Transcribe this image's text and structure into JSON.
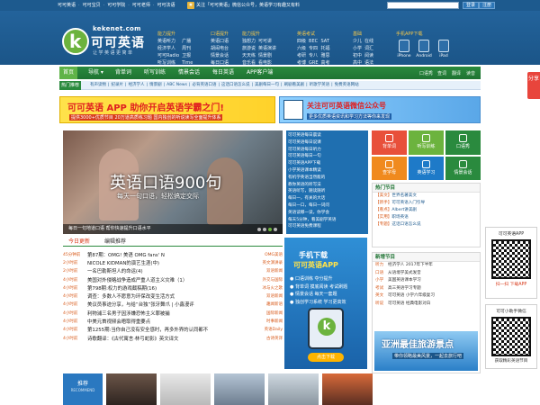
{
  "topbar": {
    "links": [
      "可可英语",
      "可可宝贝",
      "可可学院",
      "可可老师",
      "可可法语"
    ],
    "promo": "关注「可可英语」微信公众号，英语学习有趣又有料",
    "login": "登录",
    "register": "注册"
  },
  "logo": {
    "url": "kekenet.com",
    "name": "可可英语",
    "slogan": "让学英语更简单"
  },
  "nav_groups": [
    {
      "title": "能力提升",
      "items": [
        "英语听力",
        "经济学人",
        "可可Radio",
        "听写训练",
        "广播",
        "周刊",
        "卫报",
        "Time"
      ]
    },
    {
      "title": "口语提升",
      "items": [
        "英语口语",
        "胡闹电台",
        "情景会话",
        "每日口语"
      ]
    },
    {
      "title": "能力提升",
      "items": [
        "独想力",
        "旅游说",
        "天天练",
        "音乐看",
        "可可讲",
        "英语演讲",
        "情景剧",
        "看电影"
      ]
    },
    {
      "title": "英语考试",
      "items": [
        "四级",
        "六级",
        "考研",
        "考博",
        "BEC",
        "专四",
        "专八",
        "GRE",
        "SAT",
        "托福",
        "雅思",
        "高考"
      ]
    },
    {
      "title": "基础",
      "items": [
        "少儿",
        "小学",
        "初中",
        "高中",
        "在线",
        "词汇",
        "阅读",
        "语法"
      ]
    }
  ],
  "app_download": {
    "title": "手机APP下载",
    "apps": [
      "iPhone",
      "Android",
      "iPad"
    ]
  },
  "mainnav": {
    "home": "首页",
    "items": [
      "导航",
      "背单词",
      "听写训练",
      "情景会话",
      "每日英语",
      "APP客户端"
    ],
    "right": [
      "口语秀",
      "查词",
      "翻译",
      "读音"
    ]
  },
  "subnav": {
    "tag": "热门推荐",
    "links": [
      "有声读物",
      "纪录片",
      "经济学人",
      "情景剧",
      "ABC News",
      "必背英语口语",
      "这话口语怎么说",
      "美剧每日一句",
      "刷剧看美剧",
      "听歌学英语",
      "免费英语网站"
    ]
  },
  "banners": [
    {
      "title": "可可英语 APP 助你开启英语学霸之门!",
      "sub": "提供3000+优质节目 20万道高质练习题 国内独创的听说读写全面提升体系"
    },
    {
      "title": "关注可可英语微信公众号",
      "sub": "更多优质英语资讯和学习方法等你来发现"
    }
  ],
  "slider": {
    "title": "英语口语900句",
    "subtitle": "每天一句口语，轻松搞定交际",
    "caption": "每日一句地道口语 帮你快速提升口语水平"
  },
  "blue_list": [
    "可可英语每日晨读",
    "可可英语每日说课",
    "可可英语每日听力",
    "可可英语每日一句",
    "可可英语APP下载",
    "小学英语课本精读",
    "有机学英语当然能的",
    "教你英语的听写法",
    "英语听写，随读随听",
    "每日一，有关的大话",
    "每日一口，每日一词问",
    "英语读哪一读，你学会",
    "每天5分钟，看美剧学英语",
    "可可英语免费课程"
  ],
  "tiles": [
    {
      "label": "背单词",
      "color": "#e8503a"
    },
    {
      "label": "听写训练",
      "color": "#6cb33e"
    },
    {
      "label": "口语秀",
      "color": "#2a8a3e"
    },
    {
      "label": "查字母",
      "color": "#f08a1e"
    },
    {
      "label": "英语学习",
      "color": "#1e7ac8"
    },
    {
      "label": "情景会话",
      "color": "#2a8a3e"
    }
  ],
  "hot": {
    "title": "热门节目",
    "items": [
      {
        "tag": "【美文】",
        "t": "世界名著美文"
      },
      {
        "tag": "【新手】",
        "t": "可可英语入门引导"
      },
      {
        "tag": "【看点】",
        "t": "Albert讲美剧"
      },
      {
        "tag": "【实用】",
        "t": "职场英语"
      },
      {
        "tag": "【专题】",
        "t": "这话口语怎么说"
      }
    ]
  },
  "new_section": {
    "title": "新增节目",
    "items": [
      {
        "c": "听力",
        "t": "经济学人 2017年下半年"
      },
      {
        "c": "口语",
        "t": "从语境学美式发音"
      },
      {
        "c": "小学",
        "t": "美国英语课本学习"
      },
      {
        "c": "考试",
        "t": "高三英语学习专题"
      },
      {
        "c": "英文",
        "t": "可可英语 小学六年级复习"
      },
      {
        "c": "听说",
        "t": "可可英语 经典电影对白"
      }
    ],
    "ad_title": "亚洲最佳旅游景点",
    "ad_sub": "带你领略最美风景，一起去旅行吧"
  },
  "tabs": {
    "active": "今日更新",
    "inactive": "编辑推荐"
  },
  "news": [
    {
      "time": "45分钟前",
      "title": "第87期：OMG! 美语 OMG fans' N",
      "cat": "OMG美语"
    },
    {
      "time": "2小时前",
      "title": "NICOLE KIDMAN的演艺生涯(中)",
      "cat": "英文演讲录"
    },
    {
      "time": "2小时前",
      "title": "一名巴勒斯坦人的命运(4)",
      "cat": "双语新闻"
    },
    {
      "time": "4小时前",
      "title": "美国对外侵略战争造成严重人道主义灾难（1）",
      "cat": "外交与国际"
    },
    {
      "time": "4小时前",
      "title": "第798期:权力的游戏截稿期(16)",
      "cat": "冰与火之歌"
    },
    {
      "time": "4小时前",
      "title": "调查：多数人不愿意为环保改变生活方式",
      "cat": "双语新闻"
    },
    {
      "time": "4小时前",
      "title": "美议员事迹分享，与给“台独”张牙舞爪 | 小鑫漫评",
      "cat": "趣闻新语"
    },
    {
      "time": "4小时前",
      "title": "利物浦三名男子因涉嫌恐怖主义罪被捕",
      "cat": "国际新闻"
    },
    {
      "time": "4小时前",
      "title": "中美元首视频会晤取得重要点",
      "cat": "时事新闻"
    },
    {
      "time": "4小时前",
      "title": "第1255期:当你自己没有安全感时，再多外界的认同都不",
      "cat": "英语Daily"
    },
    {
      "time": "4小时前",
      "title": "诗歌翻译：《古代寓言·林弓蛇影》英文译文",
      "cat": "古诗英译"
    }
  ],
  "app_ad": {
    "title1": "手机下载",
    "title2": "可可英语APP",
    "features": [
      "口语训练 夺分提升",
      "背单词 摸底阅读 考试刷题",
      "情景会话 每天一套题",
      "独创学习系统 学习更高效"
    ],
    "download": "点击下载"
  },
  "recommend": {
    "label": "推荐",
    "en": "RECOMMEND"
  },
  "qr1": {
    "title": "可可英语APP",
    "btn": "扫一扫 下载APP"
  },
  "qr2": {
    "title": "可可小助手微信",
    "btn": "获取精彩英语节目"
  },
  "share": "分享"
}
